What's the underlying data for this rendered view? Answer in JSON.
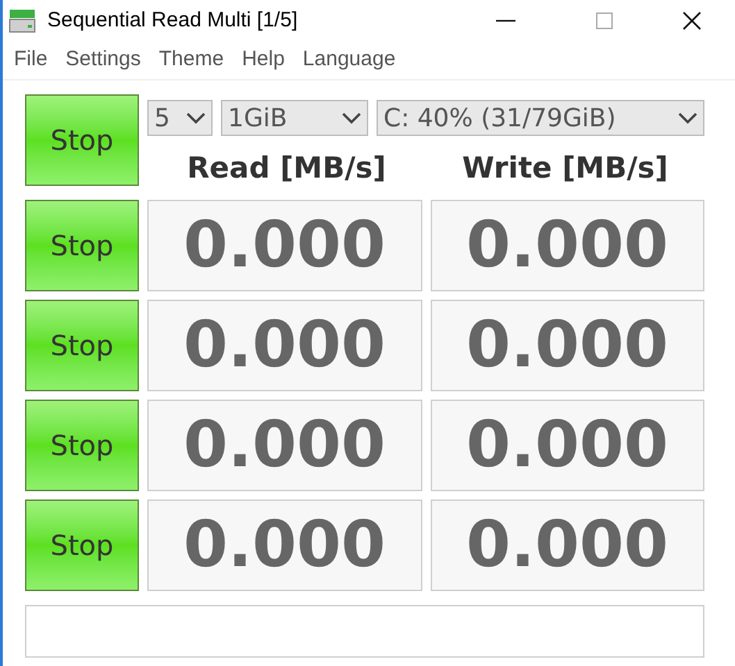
{
  "window": {
    "title": "Sequential Read Multi [1/5]"
  },
  "menu": [
    "File",
    "Settings",
    "Theme",
    "Help",
    "Language"
  ],
  "controls": {
    "button": "Stop",
    "count": "5",
    "size": "1GiB",
    "drive": "C: 40% (31/79GiB)"
  },
  "headers": [
    "Read [MB/s]",
    "Write [MB/s]"
  ],
  "rows": [
    {
      "button": "Stop",
      "read": "0.000",
      "write": "0.000"
    },
    {
      "button": "Stop",
      "read": "0.000",
      "write": "0.000"
    },
    {
      "button": "Stop",
      "read": "0.000",
      "write": "0.000"
    },
    {
      "button": "Stop",
      "read": "0.000",
      "write": "0.000"
    }
  ]
}
